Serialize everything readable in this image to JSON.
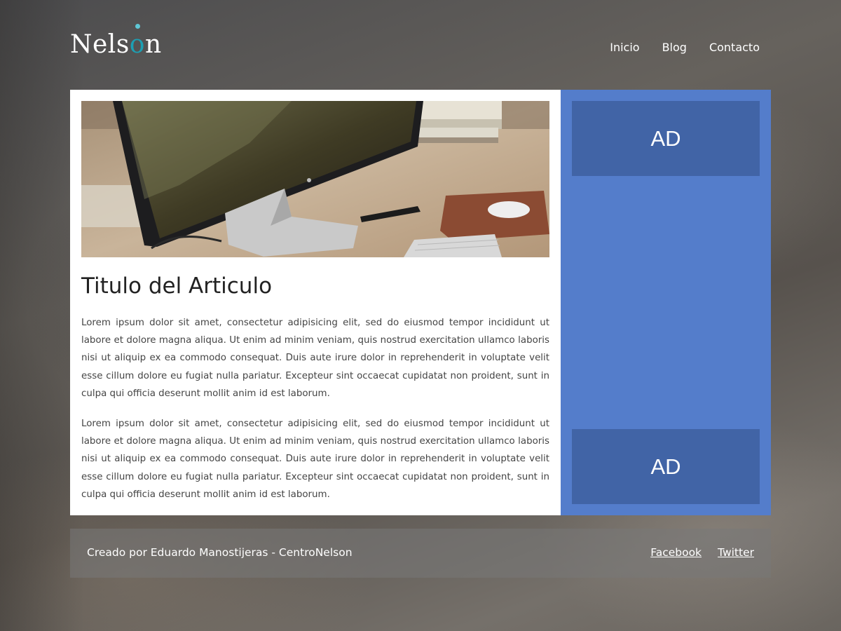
{
  "header": {
    "logo": {
      "before": "Nels",
      "accent": "o",
      "after": "n"
    },
    "nav": [
      {
        "label": "Inicio"
      },
      {
        "label": "Blog"
      },
      {
        "label": "Contacto"
      }
    ]
  },
  "article": {
    "title": "Titulo del Articulo",
    "paragraphs": [
      "Lorem ipsum dolor sit amet, consectetur adipisicing elit, sed do eiusmod tempor incididunt ut labore et dolore magna aliqua. Ut enim ad minim veniam, quis nostrud exercitation ullamco laboris nisi ut aliquip ex ea commodo consequat. Duis aute irure dolor in reprehenderit in voluptate velit esse cillum dolore eu fugiat nulla pariatur. Excepteur sint occaecat cupidatat non proident, sunt in culpa qui officia deserunt mollit anim id est laborum.",
      "Lorem ipsum dolor sit amet, consectetur adipisicing elit, sed do eiusmod tempor incididunt ut labore et dolore magna aliqua. Ut enim ad minim veniam, quis nostrud exercitation ullamco laboris nisi ut aliquip ex ea commodo consequat. Duis aute irure dolor in reprehenderit in voluptate velit esse cillum dolore eu fugiat nulla pariatur. Excepteur sint occaecat cupidatat non proident, sunt in culpa qui officia deserunt mollit anim id est laborum."
    ]
  },
  "sidebar": {
    "ads": [
      {
        "label": "AD"
      },
      {
        "label": "AD"
      }
    ]
  },
  "footer": {
    "credit": "Creado por Eduardo Manostijeras - CentroNelson",
    "links": [
      {
        "label": "Facebook"
      },
      {
        "label": "Twitter"
      }
    ]
  },
  "colors": {
    "sidebar_bg": "#547dcb",
    "ad_bg": "#4164a6",
    "logo_accent": "#1d9fb3",
    "card_bg": "#ffffff"
  }
}
